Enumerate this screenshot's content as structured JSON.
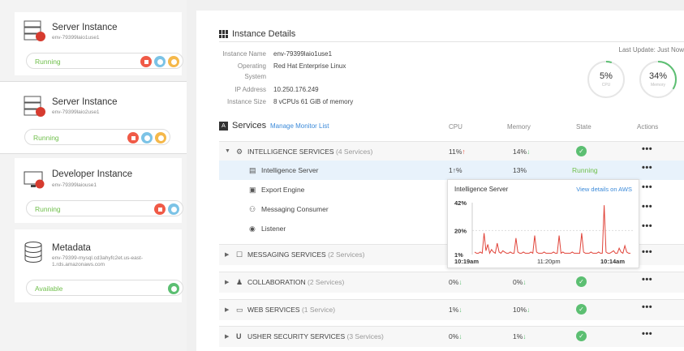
{
  "sidebar": {
    "instances": [
      {
        "title": "Server Instance",
        "id": "env-79399laio1use1",
        "status": "Running",
        "icon": "server-red-icon"
      },
      {
        "title": "Server Instance",
        "id": "env-79399laio2use1",
        "status": "Running",
        "icon": "server-red-icon"
      },
      {
        "title": "Developer Instance",
        "id": "env-79399laiouse1",
        "status": "Running",
        "icon": "monitor-icon"
      },
      {
        "title": "Metadata",
        "id": "env-79399-mysql.cd3ahyfc2et.us-east-1.rds.amazonaws.com",
        "status": "Available",
        "icon": "database-icon"
      }
    ]
  },
  "details": {
    "title": "Instance Details",
    "last_update": "Last Update: Just Now",
    "fields": [
      {
        "label": "Instance Name",
        "value": "env-79399laio1use1"
      },
      {
        "label": "Operating",
        "value": "Red Hat Enterprise Linux"
      },
      {
        "label": "System",
        "value": ""
      },
      {
        "label": "IP Address",
        "value": "10.250.176.249"
      },
      {
        "label": "Instance Size",
        "value": "8 vCPUs 61 GiB of memory"
      }
    ],
    "gauges": [
      {
        "value": "5%",
        "label": "CPU",
        "percent": 5
      },
      {
        "value": "34%",
        "label": "Memory",
        "percent": 34
      }
    ]
  },
  "services": {
    "title": "Services",
    "manage_link": "Manage Monitor List",
    "columns": {
      "cpu": "CPU",
      "memory": "Memory",
      "state": "State",
      "actions": "Actions"
    },
    "rows": [
      {
        "name": "INTELLIGENCE SERVICES",
        "count": "(4 Services)",
        "cpu": "11%",
        "cpu_trend": "↑",
        "mem": "14%",
        "mem_trend": "↓",
        "state": "ok",
        "actions": "•••",
        "expanded": true
      },
      {
        "name": "Intelligence Server",
        "cpu": "1↑%",
        "mem": "13%",
        "state_text": "Running",
        "actions": "•••",
        "sub": true
      },
      {
        "name": "Export Engine",
        "actions": "•••",
        "sub": true
      },
      {
        "name": "Messaging Consumer",
        "actions": "•••",
        "sub": true
      },
      {
        "name": "Listener",
        "actions": "•••",
        "sub": true
      },
      {
        "name": "MESSAGING SERVICES",
        "count": "(2 Services)",
        "actions": "•••"
      },
      {
        "name": "COLLABORATION",
        "count": "(2 Services)",
        "cpu": "0%",
        "cpu_trend": "↓",
        "mem": "0%",
        "mem_trend": "↓",
        "state": "ok",
        "actions": "•••"
      },
      {
        "name": "WEB SERVICES",
        "count": "(1 Service)",
        "cpu": "1%",
        "cpu_trend": "↓",
        "mem": "10%",
        "mem_trend": "↓",
        "state": "ok",
        "actions": "•••"
      },
      {
        "name": "USHER SECURITY SERVICES",
        "count": "(3 Services)",
        "cpu": "0%",
        "cpu_trend": "↓",
        "mem": "1%",
        "mem_trend": "↓",
        "state": "ok",
        "actions": "•••"
      }
    ]
  },
  "popup": {
    "title": "Intelligence Server",
    "link": "View details on AWS"
  },
  "chart_data": {
    "type": "line",
    "title": "Intelligence Server",
    "y_ticks": [
      "42%",
      "20%",
      "1%"
    ],
    "x_ticks": [
      "10:19am",
      "11:20pm",
      "10:14am"
    ],
    "ylim": [
      1,
      42
    ],
    "values": [
      3,
      2,
      2,
      3,
      2,
      18,
      4,
      9,
      2,
      5,
      3,
      2,
      10,
      3,
      2,
      4,
      3,
      2,
      2,
      3,
      2,
      2,
      14,
      3,
      2,
      2,
      3,
      2,
      2,
      2,
      3,
      2,
      16,
      3,
      2,
      2,
      2,
      3,
      2,
      2,
      2,
      2,
      3,
      2,
      2,
      16,
      2,
      3,
      2,
      2,
      2,
      2,
      3,
      2,
      2,
      2,
      2,
      18,
      3,
      2,
      2,
      2,
      3,
      2,
      2,
      2,
      3,
      2,
      2,
      40,
      3,
      2,
      2,
      3,
      4,
      2,
      2,
      6,
      3,
      2,
      8,
      3,
      2,
      2
    ],
    "color": "#e0443a"
  },
  "colors": {
    "accent": "#3b8ad9",
    "running": "#6fbf4b",
    "alert": "#f05a47"
  }
}
